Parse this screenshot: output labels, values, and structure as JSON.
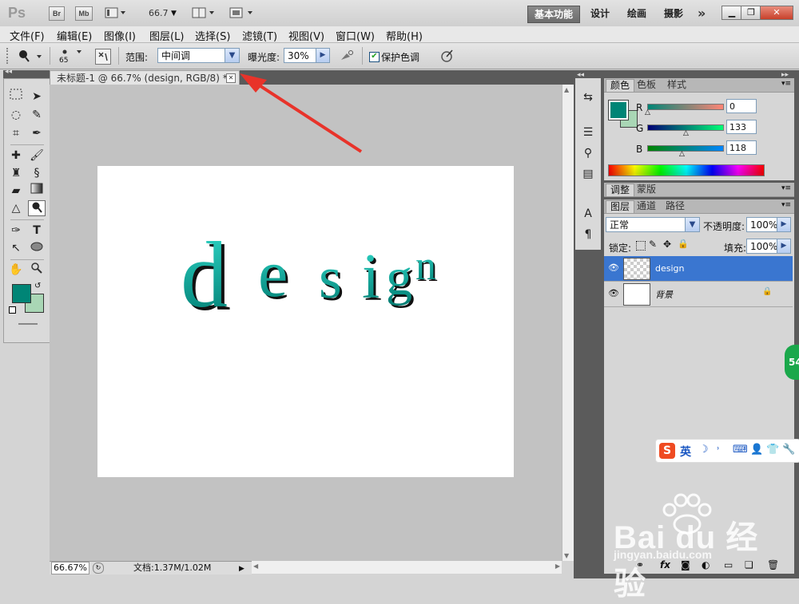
{
  "app": {
    "logo": "Ps",
    "bridge_label": "Br",
    "minibridge_label": "Mb",
    "zoom_value": "66.7",
    "workspaces": [
      "基本功能",
      "设计",
      "绘画",
      "摄影"
    ],
    "overflow": "»"
  },
  "menu": [
    "文件(F)",
    "编辑(E)",
    "图像(I)",
    "图层(L)",
    "选择(S)",
    "滤镜(T)",
    "视图(V)",
    "窗口(W)",
    "帮助(H)"
  ],
  "options": {
    "brush_size": "65",
    "range_label": "范围:",
    "range_value": "中间调",
    "exposure_label": "曝光度:",
    "exposure_value": "30%",
    "protect_tones_label": "保护色调",
    "protect_tones_checked": true
  },
  "document": {
    "tab_title": "未标题-1 @ 66.7% (design, RGB/8) *",
    "canvas_text": "design",
    "text_color": "#00a59a",
    "zoom_status": "66.67%",
    "doc_size": "文档:1.37M/1.02M"
  },
  "color_panel": {
    "tabs": [
      "颜色",
      "色板",
      "样式"
    ],
    "r_label": "R",
    "r_value": "0",
    "g_label": "G",
    "g_value": "133",
    "b_label": "B",
    "b_value": "118",
    "foreground": "#008576",
    "background": "#a9d6b5"
  },
  "adjust_panel": {
    "tabs": [
      "调整",
      "蒙版"
    ]
  },
  "layers_panel": {
    "tabs": [
      "图层",
      "通道",
      "路径"
    ],
    "blend_mode": "正常",
    "opacity_label": "不透明度:",
    "opacity_value": "100%",
    "lock_label": "锁定:",
    "fill_label": "填充:",
    "fill_value": "100%",
    "layers": [
      {
        "name": "design",
        "selected": true
      },
      {
        "name": "背景",
        "selected": false
      }
    ]
  },
  "overlay": {
    "badge": "54",
    "ime_label": "英",
    "watermark_main": "Bai du 经验",
    "watermark_url": "jingyan.baidu.com"
  }
}
